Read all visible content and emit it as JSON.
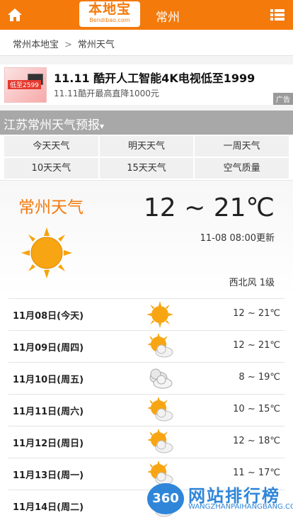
{
  "header": {
    "logo_cn": "本地宝",
    "logo_en": "Bendibao.com",
    "city": "常州"
  },
  "breadcrumb": {
    "home": "常州本地宝",
    "sep": ">",
    "current": "常州天气"
  },
  "ad": {
    "title": "11.11 酷开人工智能4K电视低至1999",
    "sub": "11.11酷开最高直降1000元",
    "price": "低至2599",
    "tag": "广告"
  },
  "section": {
    "title": "江苏常州天气预报",
    "caret": "▾"
  },
  "tabs": [
    "今天天气",
    "明天天气",
    "一周天气",
    "10天天气",
    "15天天气",
    "空气质量"
  ],
  "hero": {
    "title": "常州天气",
    "temp": "12 ~ 21℃",
    "updated": "11-08 08:00更新",
    "wind": "西北风 1级"
  },
  "forecast": [
    {
      "day": "11月08日(今天)",
      "icon": "sun-icon",
      "range": "12 ~ 21℃"
    },
    {
      "day": "11月09日(周四)",
      "icon": "partly-cloudy-icon",
      "range": "12 ~ 21℃"
    },
    {
      "day": "11月10日(周五)",
      "icon": "cloudy-icon",
      "range": "8 ~ 19℃"
    },
    {
      "day": "11月11日(周六)",
      "icon": "partly-cloudy-icon",
      "range": "10 ~ 15℃"
    },
    {
      "day": "11月12日(周日)",
      "icon": "partly-cloudy-icon",
      "range": "12 ~ 18℃"
    },
    {
      "day": "11月13日(周一)",
      "icon": "partly-cloudy-icon",
      "range": "11 ~ 17℃"
    },
    {
      "day": "11月14日(周二)",
      "icon": "partly-cloudy-icon",
      "range": ""
    }
  ],
  "watermark": {
    "badge": "360",
    "title": "网站排行榜",
    "sub": "WANGZHANPAIHANGBANG.COM"
  },
  "colors": {
    "brand": "#f47a0c",
    "section": "#a8a8a8",
    "watermark": "#2f86d9"
  }
}
